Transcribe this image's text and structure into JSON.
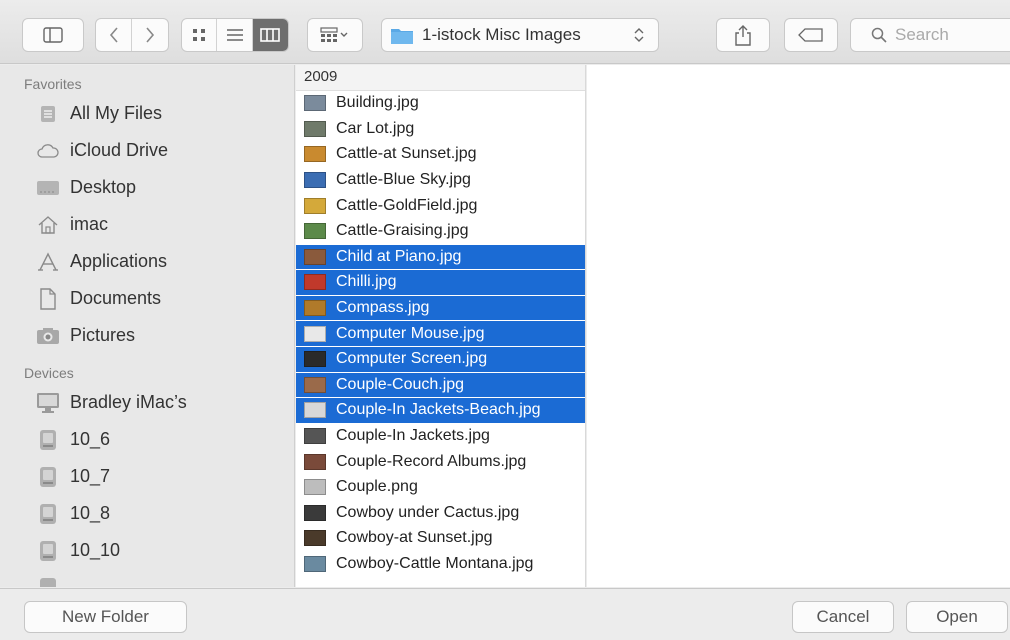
{
  "toolbar": {
    "location": "1-istock Misc Images",
    "search_placeholder": "Search",
    "active_view": "columns",
    "accent": "#1b6bd4"
  },
  "sidebar": {
    "favorites_title": "Favorites",
    "favorites": [
      {
        "label": "All My Files",
        "icon": "all-files-icon"
      },
      {
        "label": "iCloud Drive",
        "icon": "cloud-icon"
      },
      {
        "label": "Desktop",
        "icon": "desktop-icon"
      },
      {
        "label": "imac",
        "icon": "home-icon"
      },
      {
        "label": "Applications",
        "icon": "applications-icon"
      },
      {
        "label": "Documents",
        "icon": "document-icon"
      },
      {
        "label": "Pictures",
        "icon": "camera-icon"
      }
    ],
    "devices_title": "Devices",
    "devices": [
      {
        "label": "Bradley iMac’s",
        "icon": "computer-icon"
      },
      {
        "label": "10_6",
        "icon": "disk-icon"
      },
      {
        "label": "10_7",
        "icon": "disk-icon"
      },
      {
        "label": "10_8",
        "icon": "disk-icon"
      },
      {
        "label": "10_10",
        "icon": "disk-icon"
      }
    ]
  },
  "browser": {
    "column_header": "2009",
    "files": [
      {
        "name": "Building.jpg",
        "selected": false,
        "thumb": "#7b8b9c"
      },
      {
        "name": "Car Lot.jpg",
        "selected": false,
        "thumb": "#6f7a6a"
      },
      {
        "name": "Cattle-at Sunset.jpg",
        "selected": false,
        "thumb": "#c98a2f"
      },
      {
        "name": "Cattle-Blue Sky.jpg",
        "selected": false,
        "thumb": "#3b6db3"
      },
      {
        "name": "Cattle-GoldField.jpg",
        "selected": false,
        "thumb": "#d4a93a"
      },
      {
        "name": "Cattle-Graising.jpg",
        "selected": false,
        "thumb": "#5c8a4a"
      },
      {
        "name": "Child at Piano.jpg",
        "selected": true,
        "thumb": "#8a5a3c"
      },
      {
        "name": "Chilli.jpg",
        "selected": true,
        "thumb": "#c0392b"
      },
      {
        "name": "Compass.jpg",
        "selected": true,
        "thumb": "#b07a2a"
      },
      {
        "name": "Computer Mouse.jpg",
        "selected": true,
        "thumb": "#e8e8e8"
      },
      {
        "name": "Computer Screen.jpg",
        "selected": true,
        "thumb": "#2a2a2a"
      },
      {
        "name": "Couple-Couch.jpg",
        "selected": true,
        "thumb": "#9a6a4a"
      },
      {
        "name": "Couple-In Jackets-Beach.jpg",
        "selected": true,
        "thumb": "#d8d8d8"
      },
      {
        "name": "Couple-In Jackets.jpg",
        "selected": false,
        "thumb": "#555555"
      },
      {
        "name": "Couple-Record Albums.jpg",
        "selected": false,
        "thumb": "#7a4a3a"
      },
      {
        "name": "Couple.png",
        "selected": false,
        "thumb": "#bdbdbd"
      },
      {
        "name": "Cowboy under Cactus.jpg",
        "selected": false,
        "thumb": "#3a3a3a"
      },
      {
        "name": "Cowboy-at Sunset.jpg",
        "selected": false,
        "thumb": "#4a3a2a"
      },
      {
        "name": "Cowboy-Cattle Montana.jpg",
        "selected": false,
        "thumb": "#6a8aa0"
      }
    ]
  },
  "buttons": {
    "new_folder": "New Folder",
    "cancel": "Cancel",
    "open": "Open"
  }
}
